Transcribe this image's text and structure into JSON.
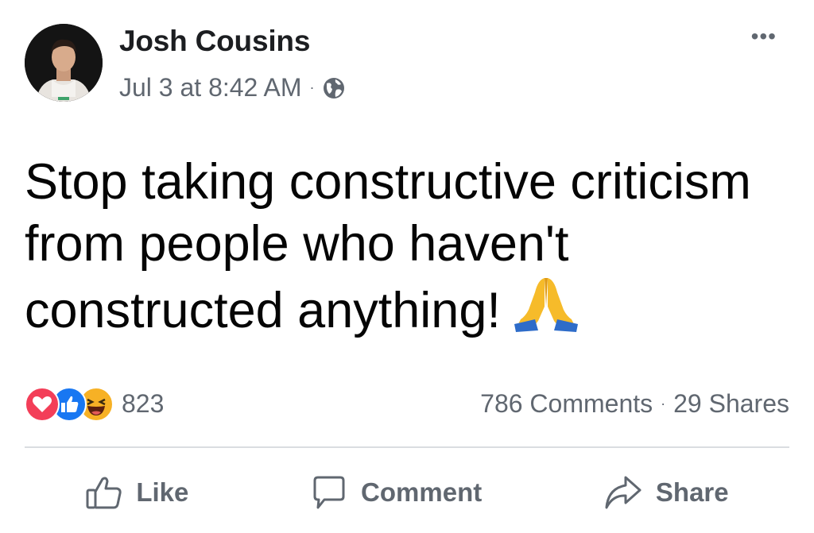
{
  "post": {
    "author": "Josh Cousins",
    "timestamp": "Jul 3 at 8:42 AM",
    "separator": "·",
    "privacy_icon": "globe-icon",
    "more_label": "•••",
    "text_lines": [
      "Stop taking constructive criticism",
      "from people who haven't",
      "constructed anything!"
    ],
    "emoji": "folded-hands-emoji"
  },
  "reactions": {
    "types": [
      "love-reaction-icon",
      "like-reaction-icon",
      "haha-reaction-icon"
    ],
    "count": "823",
    "comments": "786 Comments",
    "separator": "·",
    "shares": "29 Shares"
  },
  "actions": {
    "like": "Like",
    "comment": "Comment",
    "share": "Share"
  },
  "colors": {
    "love": "#f33e58",
    "like": "#1877f2",
    "haha": "#f7b125",
    "secondary_text": "#606770",
    "divider": "#dadde1"
  }
}
